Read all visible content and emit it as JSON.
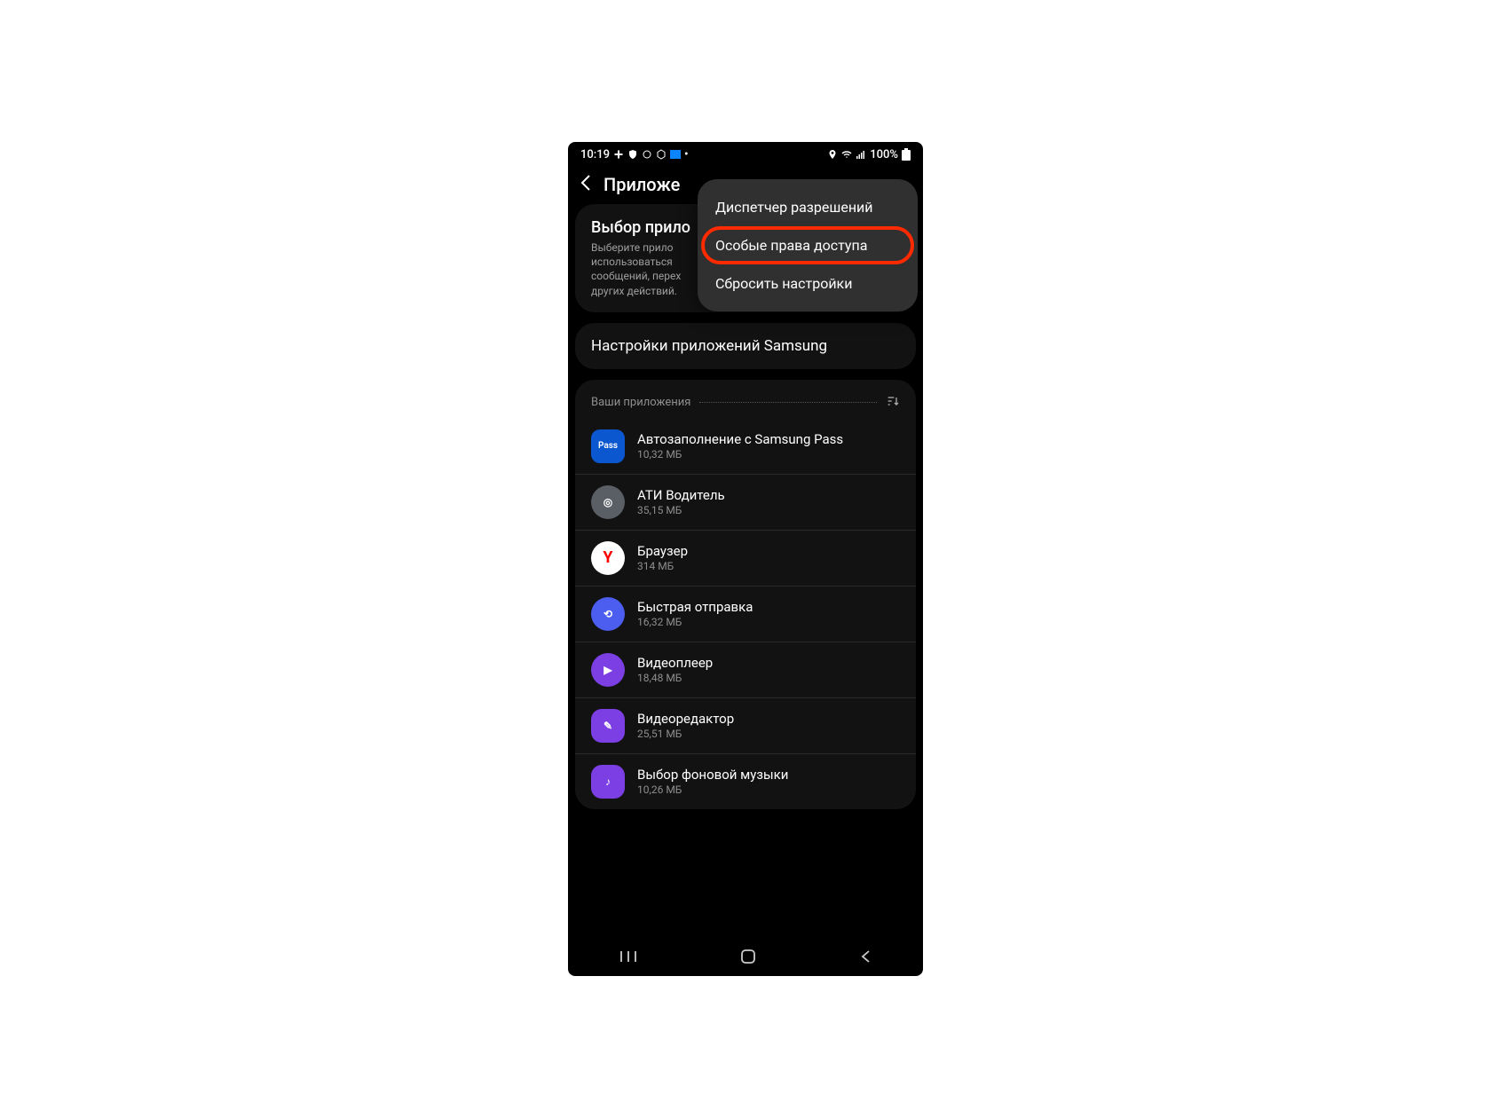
{
  "statusbar": {
    "time": "10:19",
    "battery": "100%"
  },
  "header": {
    "title": "Приложе"
  },
  "sections": {
    "choose": {
      "title": "Выбор прило",
      "desc": "Выберите прило\nиспользоваться\nсообщений, перех\nдругих действий."
    },
    "samsung": {
      "title": "Настройки приложений Samsung"
    },
    "apps": {
      "header": "Ваши приложения"
    }
  },
  "menu": {
    "items": [
      "Диспетчер разрешений",
      "Особые права доступа",
      "Сбросить настройки"
    ]
  },
  "apps": [
    {
      "name": "Автозаполнение с Samsung Pass",
      "size": "10,32 МБ",
      "iconClass": "icon-pass",
      "iconText": "Pass"
    },
    {
      "name": "АТИ Водитель",
      "size": "35,15 МБ",
      "iconClass": "icon-ati",
      "iconText": "◎"
    },
    {
      "name": "Браузер",
      "size": "314 МБ",
      "iconClass": "icon-yandex",
      "iconText": "Y"
    },
    {
      "name": "Быстрая отправка",
      "size": "16,32 МБ",
      "iconClass": "icon-quick",
      "iconText": "⟲"
    },
    {
      "name": "Видеоплеер",
      "size": "18,48 МБ",
      "iconClass": "icon-video",
      "iconText": "▶"
    },
    {
      "name": "Видеоредактор",
      "size": "25,51 МБ",
      "iconClass": "icon-videored",
      "iconText": "✎"
    },
    {
      "name": "Выбор фоновой музыки",
      "size": "10,26 МБ",
      "iconClass": "icon-music",
      "iconText": "♪"
    }
  ]
}
